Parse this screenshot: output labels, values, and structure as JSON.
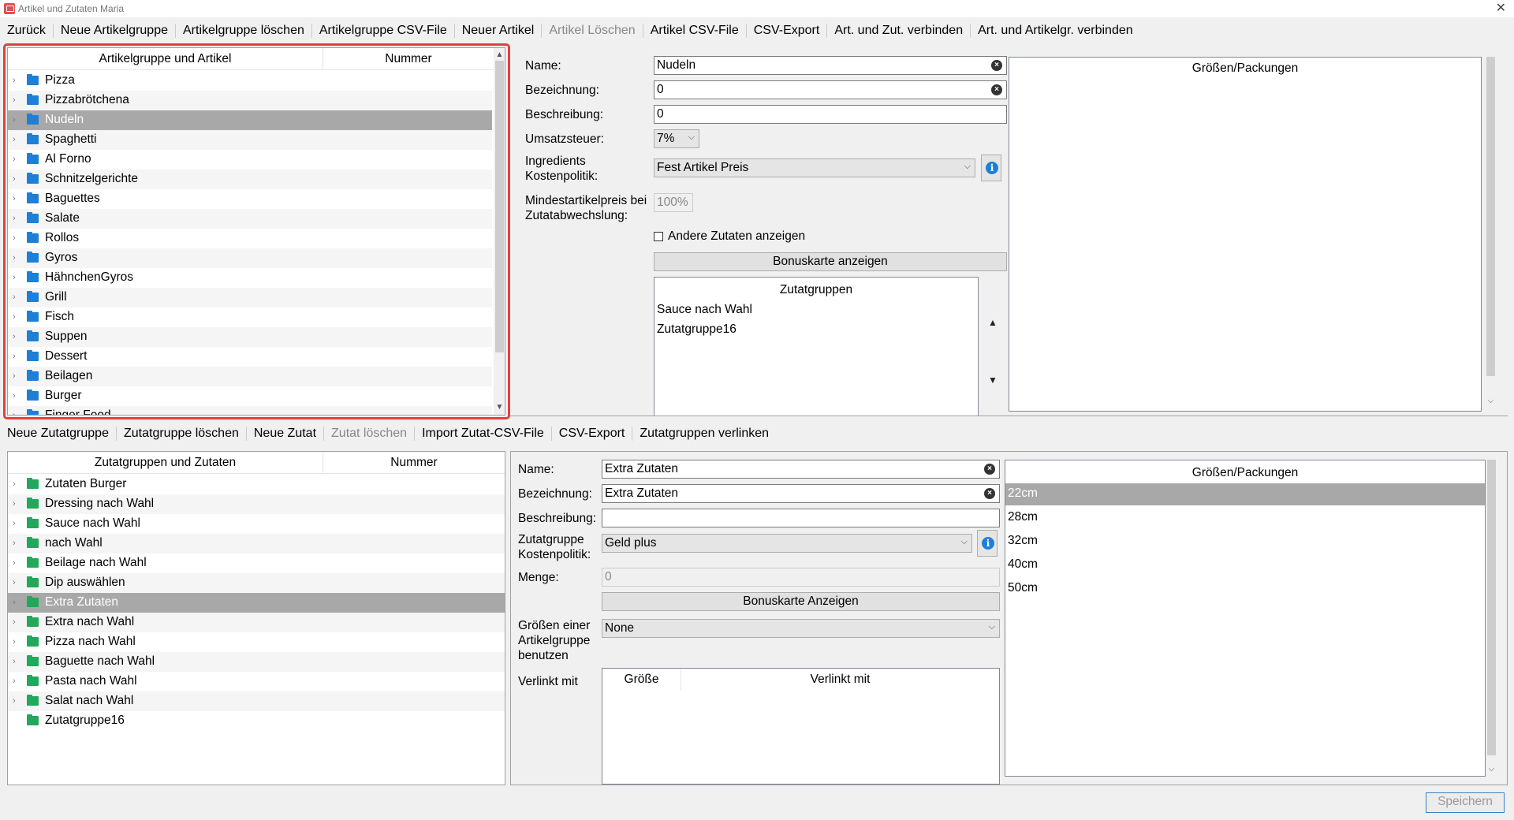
{
  "window": {
    "title": "Artikel und Zutaten Maria"
  },
  "top_menu": [
    {
      "label": "Zurück",
      "disabled": false
    },
    {
      "label": "Neue Artikelgruppe",
      "disabled": false
    },
    {
      "label": "Artikelgruppe löschen",
      "disabled": false
    },
    {
      "label": "Artikelgruppe CSV-File",
      "disabled": false
    },
    {
      "label": "Neuer Artikel",
      "disabled": false
    },
    {
      "label": "Artikel Löschen",
      "disabled": true
    },
    {
      "label": "Artikel CSV-File",
      "disabled": false
    },
    {
      "label": "CSV-Export",
      "disabled": false
    },
    {
      "label": "Art. und Zut. verbinden",
      "disabled": false
    },
    {
      "label": "Art. und Artikelgr. verbinden",
      "disabled": false
    }
  ],
  "article_tree": {
    "col1": "Artikelgruppe und Artikel",
    "col2": "Nummer",
    "items": [
      "Pizza",
      "Pizzabrötchena",
      "Nudeln",
      "Spaghetti",
      "Al Forno",
      "Schnitzelgerichte",
      "Baguettes",
      "Salate",
      "Rollos",
      "Gyros",
      "HähnchenGyros",
      "Grill",
      "Fisch",
      "Suppen",
      "Dessert",
      "Beilagen",
      "Burger",
      "Finger Food"
    ],
    "selected_index": 2
  },
  "article_form": {
    "name_label": "Name:",
    "name_value": "Nudeln",
    "bez_label": "Bezeichnung:",
    "bez_value": "0",
    "beschr_label": "Beschreibung:",
    "beschr_value": "0",
    "ust_label": "Umsatzsteuer:",
    "ust_value": "7%",
    "ingr_label_1": "Ingredients",
    "ingr_label_2": "Kostenpolitik:",
    "ingr_value": "Fest Artikel Preis",
    "min_label_1": "Mindestartikelpreis bei",
    "min_label_2": "Zutatabwechslung:",
    "min_value": "100%",
    "andere_label": "Andere Zutaten anzeigen",
    "bonus_label": "Bonuskarte anzeigen",
    "zutatgruppen_title": "Zutatgruppen",
    "zutatgruppen": [
      "Sauce nach Wahl",
      "Zutatgruppe16"
    ],
    "sizes_title": "Größen/Packungen"
  },
  "bottom_menu": [
    {
      "label": "Neue Zutatgruppe",
      "disabled": false
    },
    {
      "label": "Zutatgruppe löschen",
      "disabled": false
    },
    {
      "label": "Neue Zutat",
      "disabled": false
    },
    {
      "label": "Zutat löschen",
      "disabled": true
    },
    {
      "label": "Import Zutat-CSV-File",
      "disabled": false
    },
    {
      "label": "CSV-Export",
      "disabled": false
    },
    {
      "label": "Zutatgruppen verlinken",
      "disabled": false
    }
  ],
  "ingredient_tree": {
    "col1": "Zutatgruppen und Zutaten",
    "col2": "Nummer",
    "items": [
      "Zutaten Burger",
      "Dressing nach Wahl",
      "Sauce nach Wahl",
      "nach Wahl",
      "Beilage nach Wahl",
      "Dip auswählen",
      "Extra Zutaten",
      "Extra nach Wahl",
      "Pizza nach Wahl",
      "Baguette nach Wahl",
      "Pasta nach Wahl",
      "Salat nach Wahl",
      "Zutatgruppe16"
    ],
    "selected_index": 6
  },
  "ingredient_form": {
    "name_label": "Name:",
    "name_value": "Extra Zutaten",
    "bez_label": "Bezeichnung:",
    "bez_value": "Extra Zutaten",
    "beschr_label": "Beschreibung:",
    "beschr_value": "",
    "kp_label_1": "Zutatgruppe",
    "kp_label_2": "Kostenpolitik:",
    "kp_value": "Geld plus",
    "menge_label": "Menge:",
    "menge_value": "0",
    "bonus_label": "Bonuskarte Anzeigen",
    "groessen_label_1": "Größen einer",
    "groessen_label_2": "Artikelgruppe",
    "groessen_label_3": "benutzen",
    "groessen_value": "None",
    "verlinkt_label": "Verlinkt mit",
    "link_col1": "Größe",
    "link_col2": "Verlinkt mit",
    "sizes_title": "Größen/Packungen",
    "sizes": [
      "22cm",
      "28cm",
      "32cm",
      "40cm",
      "50cm"
    ],
    "sizes_selected": 0
  },
  "save_label": "Speichern"
}
